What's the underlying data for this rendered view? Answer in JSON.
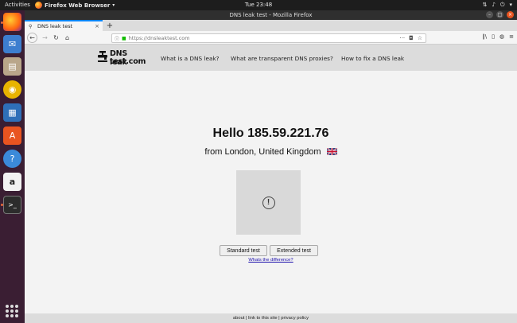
{
  "topbar": {
    "activities": "Activities",
    "app_name": "Firefox Web Browser",
    "clock": "Tue 23:48"
  },
  "window": {
    "title": "DNS leak test - Mozilla Firefox"
  },
  "tabs": [
    {
      "label": "DNS leak test"
    }
  ],
  "urlbar": {
    "url": "https://dnsleaktest.com"
  },
  "site": {
    "logo_line1": "DNS leak",
    "logo_line2": "test.com",
    "nav": [
      "What is a DNS leak?",
      "What are transparent DNS proxies?",
      "How to fix a DNS leak"
    ],
    "hello": "Hello 185.59.221.76",
    "location": "from London, United Kingdom",
    "buttons": {
      "standard": "Standard test",
      "extended": "Extended test"
    },
    "difference_link": "Whats the difference?",
    "footer": "about | link to this site | privacy policy"
  },
  "colors": {
    "accent_tab": "#0a84ff",
    "dock_bg": "#3a1e33",
    "close_button": "#e95420"
  }
}
